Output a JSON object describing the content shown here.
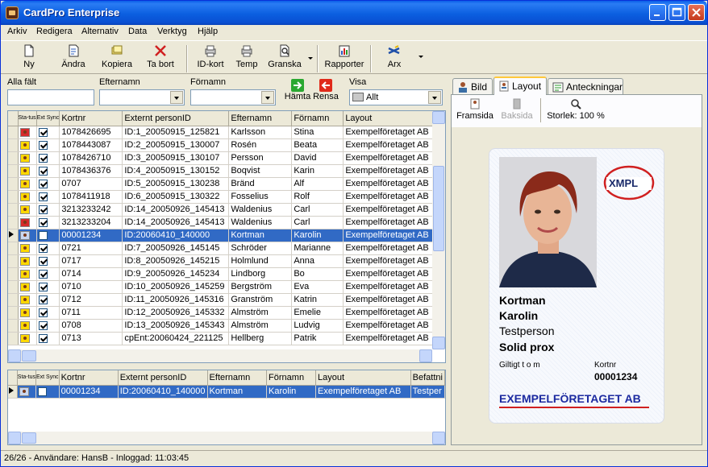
{
  "window": {
    "title": "CardPro Enterprise"
  },
  "menu": [
    "Arkiv",
    "Redigera",
    "Alternativ",
    "Data",
    "Verktyg",
    "Hjälp"
  ],
  "toolbar": {
    "ny": "Ny",
    "andra": "Ändra",
    "kopiera": "Kopiera",
    "ta_bort": "Ta bort",
    "id_kort": "ID-kort",
    "temp": "Temp",
    "granska": "Granska",
    "rapporter": "Rapporter",
    "arx": "Arx"
  },
  "filters": {
    "alla_falt": "Alla fält",
    "efternamn": "Efternamn",
    "fornamn": "Förnamn",
    "hamta": "Hämta",
    "rensa": "Rensa",
    "visa": "Visa",
    "visa_value": "Allt"
  },
  "grid": {
    "columns": [
      "Sta-tus",
      "Ext Sync",
      "Kortnr",
      "Externt personID",
      "Efternamn",
      "Förnamn",
      "Layout"
    ],
    "rows": [
      {
        "status": "red",
        "sync": true,
        "kortnr": "1078426695",
        "ext": "ID:1_20050915_125821",
        "efternamn": "Karlsson",
        "fornamn": "Stina",
        "layout": "Exempelföretaget AB"
      },
      {
        "status": "yellow",
        "sync": true,
        "kortnr": "1078443087",
        "ext": "ID:2_20050915_130007",
        "efternamn": "Rosén",
        "fornamn": "Beata",
        "layout": "Exempelföretaget AB"
      },
      {
        "status": "yellow",
        "sync": true,
        "kortnr": "1078426710",
        "ext": "ID:3_20050915_130107",
        "efternamn": "Persson",
        "fornamn": "David",
        "layout": "Exempelföretaget AB"
      },
      {
        "status": "yellow",
        "sync": true,
        "kortnr": "1078436376",
        "ext": "ID:4_20050915_130152",
        "efternamn": "Boqvist",
        "fornamn": "Karin",
        "layout": "Exempelföretaget AB"
      },
      {
        "status": "yellow",
        "sync": true,
        "kortnr": "0707",
        "ext": "ID:5_20050915_130238",
        "efternamn": "Bränd",
        "fornamn": "Alf",
        "layout": "Exempelföretaget AB"
      },
      {
        "status": "yellow",
        "sync": true,
        "kortnr": "1078411918",
        "ext": "ID:6_20050915_130322",
        "efternamn": "Fosselius",
        "fornamn": "Rolf",
        "layout": "Exempelföretaget AB"
      },
      {
        "status": "yellow",
        "sync": true,
        "kortnr": "3213233242",
        "ext": "ID:14_20050926_145413",
        "efternamn": "Waldenius",
        "fornamn": "Carl",
        "layout": "Exempelföretaget AB"
      },
      {
        "status": "red",
        "sync": true,
        "kortnr": "3213233204",
        "ext": "ID:14_20050926_145413",
        "efternamn": "Waldenius",
        "fornamn": "Carl",
        "layout": "Exempelföretaget AB"
      },
      {
        "status": "blue",
        "sync": false,
        "kortnr": "00001234",
        "ext": "ID:20060410_140000",
        "efternamn": "Kortman",
        "fornamn": "Karolin",
        "layout": "Exempelföretaget AB",
        "selected": true
      },
      {
        "status": "yellow",
        "sync": true,
        "kortnr": "0721",
        "ext": "ID:7_20050926_145145",
        "efternamn": "Schröder",
        "fornamn": "Marianne",
        "layout": "Exempelföretaget AB"
      },
      {
        "status": "yellow",
        "sync": true,
        "kortnr": "0717",
        "ext": "ID:8_20050926_145215",
        "efternamn": "Holmlund",
        "fornamn": "Anna",
        "layout": "Exempelföretaget AB"
      },
      {
        "status": "yellow",
        "sync": true,
        "kortnr": "0714",
        "ext": "ID:9_20050926_145234",
        "efternamn": "Lindborg",
        "fornamn": "Bo",
        "layout": "Exempelföretaget AB"
      },
      {
        "status": "yellow",
        "sync": true,
        "kortnr": "0710",
        "ext": "ID:10_20050926_145259",
        "efternamn": "Bergström",
        "fornamn": "Eva",
        "layout": "Exempelföretaget AB"
      },
      {
        "status": "yellow",
        "sync": true,
        "kortnr": "0712",
        "ext": "ID:11_20050926_145316",
        "efternamn": "Granström",
        "fornamn": "Katrin",
        "layout": "Exempelföretaget AB"
      },
      {
        "status": "yellow",
        "sync": true,
        "kortnr": "0711",
        "ext": "ID:12_20050926_145332",
        "efternamn": "Almström",
        "fornamn": "Emelie",
        "layout": "Exempelföretaget AB"
      },
      {
        "status": "yellow",
        "sync": true,
        "kortnr": "0708",
        "ext": "ID:13_20050926_145343",
        "efternamn": "Almström",
        "fornamn": "Ludvig",
        "layout": "Exempelföretaget AB"
      },
      {
        "status": "yellow",
        "sync": true,
        "kortnr": "0713",
        "ext": "cpEnt:20060424_221125",
        "efternamn": "Hellberg",
        "fornamn": "Patrik",
        "layout": "Exempelföretaget AB"
      }
    ]
  },
  "grid2": {
    "columns": [
      "Sta-tus",
      "Ext Sync",
      "Kortnr",
      "Externt personID",
      "Efternamn",
      "Förnamn",
      "Layout",
      "Befattni"
    ],
    "rows": [
      {
        "status": "blue",
        "sync": false,
        "kortnr": "00001234",
        "ext": "ID:20060410_140000",
        "efternamn": "Kortman",
        "fornamn": "Karolin",
        "layout": "Exempelföretaget AB",
        "befattning": "Testper",
        "selected": true
      }
    ]
  },
  "tabs": [
    "Bild",
    "Layout",
    "Anteckningar"
  ],
  "preview": {
    "framsida": "Framsida",
    "baksida": "Baksida",
    "storlek": "Storlek: 100 %"
  },
  "card": {
    "logo": "XMPL",
    "lastname": "Kortman",
    "firstname": "Karolin",
    "role": "Testperson",
    "cardtype": "Solid prox",
    "valid_label": "Giltigt t o m",
    "kortnr_label": "Kortnr",
    "kortnr": "00001234",
    "company": "EXEMPELFÖRETAGET AB"
  },
  "statusbar": "26/26 - Användare: HansB - Inloggad: 11:03:45"
}
